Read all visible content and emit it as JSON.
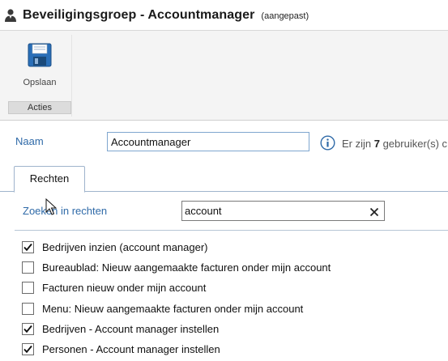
{
  "window": {
    "title": "Beveiligingsgroep - Accountmanager",
    "badge": "(aangepast)",
    "icon": "user-group-icon"
  },
  "ribbon": {
    "save_label": "Opslaan",
    "save_icon": "floppy-disk-icon",
    "group_label": "Acties"
  },
  "form": {
    "name_label": "Naam",
    "name_value": "Accountmanager",
    "info_icon": "info-icon",
    "info_prefix": "Er zijn ",
    "info_count": "7",
    "info_suffix": " gebruiker(s) c"
  },
  "tabs": [
    {
      "label": "Rechten",
      "active": true
    }
  ],
  "search": {
    "label": "Zoeken in rechten",
    "value": "account",
    "clear_icon": "close-icon"
  },
  "permissions": [
    {
      "label": "Bedrijven inzien (account manager)",
      "checked": true
    },
    {
      "label": "Bureaublad: Nieuw aangemaakte facturen onder mijn account",
      "checked": false
    },
    {
      "label": "Facturen nieuw onder mijn account",
      "checked": false
    },
    {
      "label": "Menu: Nieuw aangemaakte facturen onder mijn account",
      "checked": false
    },
    {
      "label": "Bedrijven - Account manager instellen",
      "checked": true
    },
    {
      "label": "Personen - Account manager instellen",
      "checked": true
    }
  ],
  "colors": {
    "label_blue": "#2f6aa8",
    "input_border": "#7fa6cf",
    "ribbon_bg": "#f4f4f4"
  }
}
